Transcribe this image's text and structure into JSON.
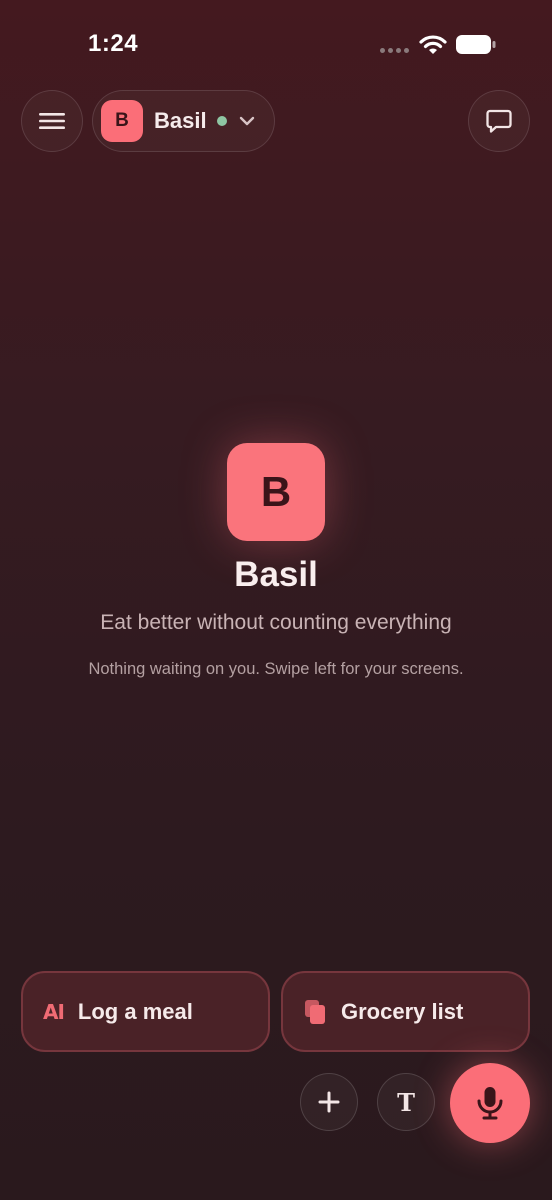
{
  "status_bar": {
    "time": "1:24"
  },
  "header": {
    "assistant": {
      "avatar_letter": "B",
      "name": "Basil",
      "online": true
    }
  },
  "hero": {
    "logo_letter": "B",
    "title": "Basil",
    "tagline": "Eat better without counting everything",
    "note": "Nothing waiting on you. Swipe left for your screens."
  },
  "actions": [
    {
      "label": "Log a meal",
      "icon": "ai-text-icon",
      "icon_text": "AI"
    },
    {
      "label": "Grocery list",
      "icon": "copy-icon"
    }
  ],
  "controls": {
    "add_icon": "plus-icon",
    "text_mode_glyph": "T",
    "mic_icon": "microphone-icon"
  },
  "colors": {
    "accent": "#fb6e78",
    "background": "#361b21",
    "online": "#8fc6a3",
    "card_bg": "#4a2227",
    "card_border": "#76363d"
  }
}
